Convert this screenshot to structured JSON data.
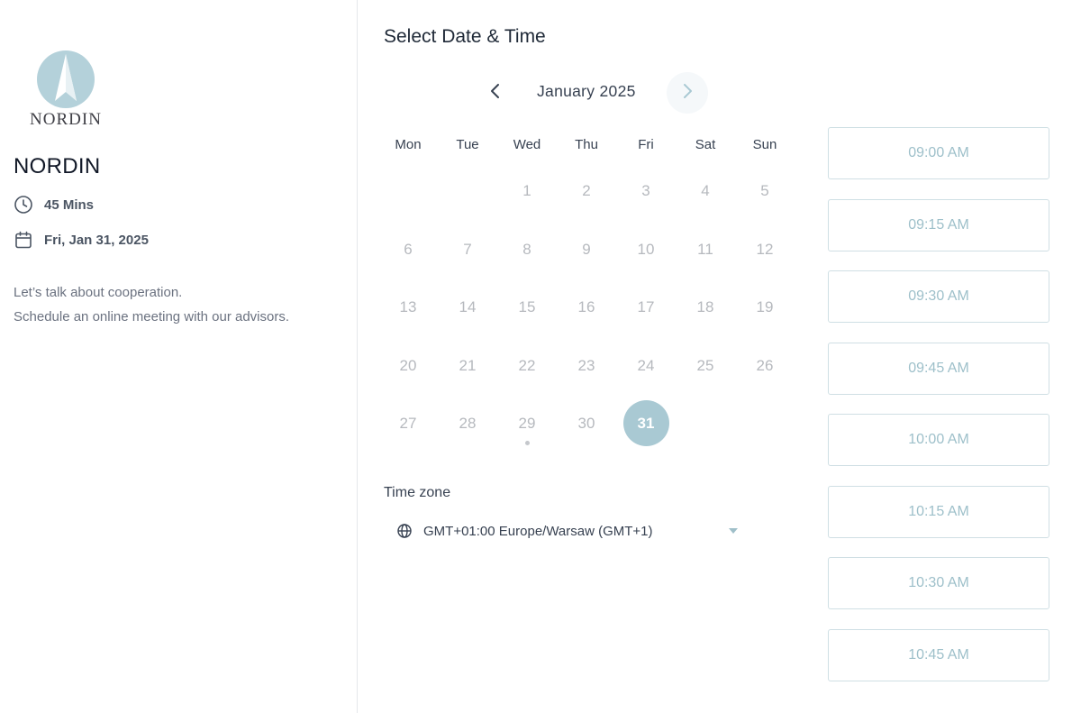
{
  "brand": {
    "logo_text": "NORDIN",
    "name": "NORDIN",
    "accent": "#a9c9d3"
  },
  "event": {
    "duration": "45 Mins",
    "date": "Fri, Jan 31, 2025",
    "description_lines": [
      "Let’s talk about cooperation.",
      "Schedule an online meeting with our advisors."
    ]
  },
  "page_title": "Select Date & Time",
  "calendar": {
    "month_label": "January 2025",
    "weekdays": [
      "Mon",
      "Tue",
      "Wed",
      "Thu",
      "Fri",
      "Sat",
      "Sun"
    ],
    "weeks": [
      [
        "",
        "",
        "1",
        "2",
        "3",
        "4",
        "5"
      ],
      [
        "6",
        "7",
        "8",
        "9",
        "10",
        "11",
        "12"
      ],
      [
        "13",
        "14",
        "15",
        "16",
        "17",
        "18",
        "19"
      ],
      [
        "20",
        "21",
        "22",
        "23",
        "24",
        "25",
        "26"
      ],
      [
        "27",
        "28",
        "29",
        "30",
        "31",
        "",
        ""
      ]
    ],
    "selected_day": "31",
    "today_marker_day": "29"
  },
  "timezone": {
    "label": "Time zone",
    "value": "GMT+01:00 Europe/Warsaw (GMT+1)"
  },
  "time_slots": [
    "09:00 AM",
    "09:15 AM",
    "09:30 AM",
    "09:45 AM",
    "10:00 AM",
    "10:15 AM",
    "10:30 AM",
    "10:45 AM"
  ]
}
